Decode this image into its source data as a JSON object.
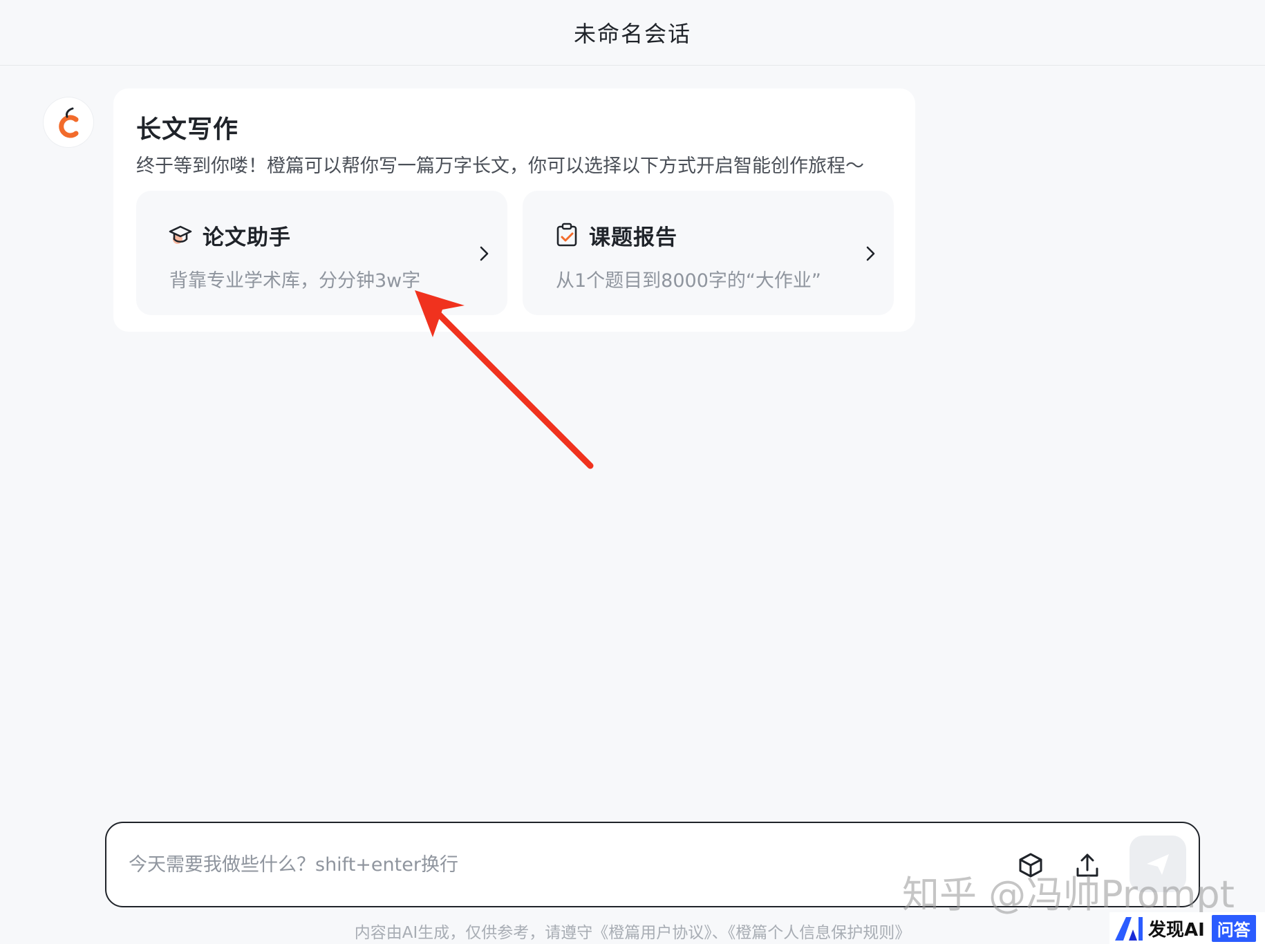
{
  "header": {
    "title": "未命名会话"
  },
  "card": {
    "title": "长文写作",
    "description": "终于等到你喽！橙篇可以帮你写一篇万字长文，你可以选择以下方式开启智能创作旅程～",
    "options": [
      {
        "icon": "graduation-cap-icon",
        "title": "论文助手",
        "subtitle": "背靠专业学术库，分分钟3w字"
      },
      {
        "icon": "clipboard-check-icon",
        "title": "课题报告",
        "subtitle": "从1个题目到8000字的“大作业”"
      }
    ]
  },
  "input": {
    "placeholder": "今天需要我做些什么？shift+enter换行"
  },
  "footer": {
    "disclaimer": "内容由AI生成，仅供参考，请遵守《橙篇用户协议》、《橙篇个人信息保护规则》"
  },
  "watermarks": {
    "zhihu": "知乎 @冯帅Prompt",
    "brand": "发现AI",
    "qa": "问答"
  },
  "colors": {
    "accent": "#f26b2b",
    "annotation": "#f0321e",
    "badge": "#2b5cff"
  }
}
